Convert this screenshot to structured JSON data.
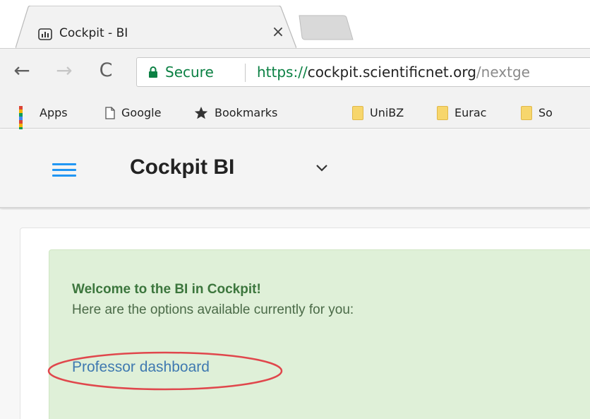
{
  "browser": {
    "tab": {
      "title": "Cockpit - BI",
      "close_glyph": "×",
      "favicon": "cockpit-bars-icon"
    },
    "nav": {
      "back_glyph": "←",
      "forward_glyph": "→",
      "reload_glyph": "C"
    },
    "omnibox": {
      "secure_label": "Secure",
      "url_scheme": "https://",
      "url_host": "cockpit.scientificnet.org",
      "url_path": "/nextge"
    },
    "bookmarks": [
      {
        "label": "Apps",
        "icon": "apps-grid-icon"
      },
      {
        "label": "Google",
        "icon": "page-icon"
      },
      {
        "label": "Bookmarks",
        "icon": "star-icon"
      },
      {
        "label": "UniBZ",
        "icon": "folder-icon"
      },
      {
        "label": "Eurac",
        "icon": "folder-icon"
      },
      {
        "label": "So",
        "icon": "folder-icon"
      }
    ]
  },
  "app": {
    "title": "Cockpit BI",
    "menu_icon": "hamburger-menu-icon",
    "dropdown_icon": "chevron-down-icon"
  },
  "welcome": {
    "heading": "Welcome to the BI in Cockpit!",
    "text": "Here are the options available currently for you:",
    "link_label": "Professor dashboard"
  },
  "colors": {
    "accent_blue": "#2196f3",
    "secure_green": "#0b8043",
    "alert_bg": "#dff0d8",
    "alert_heading": "#3c763d",
    "link": "#3f79b0",
    "annotation_red": "#e0474c"
  }
}
